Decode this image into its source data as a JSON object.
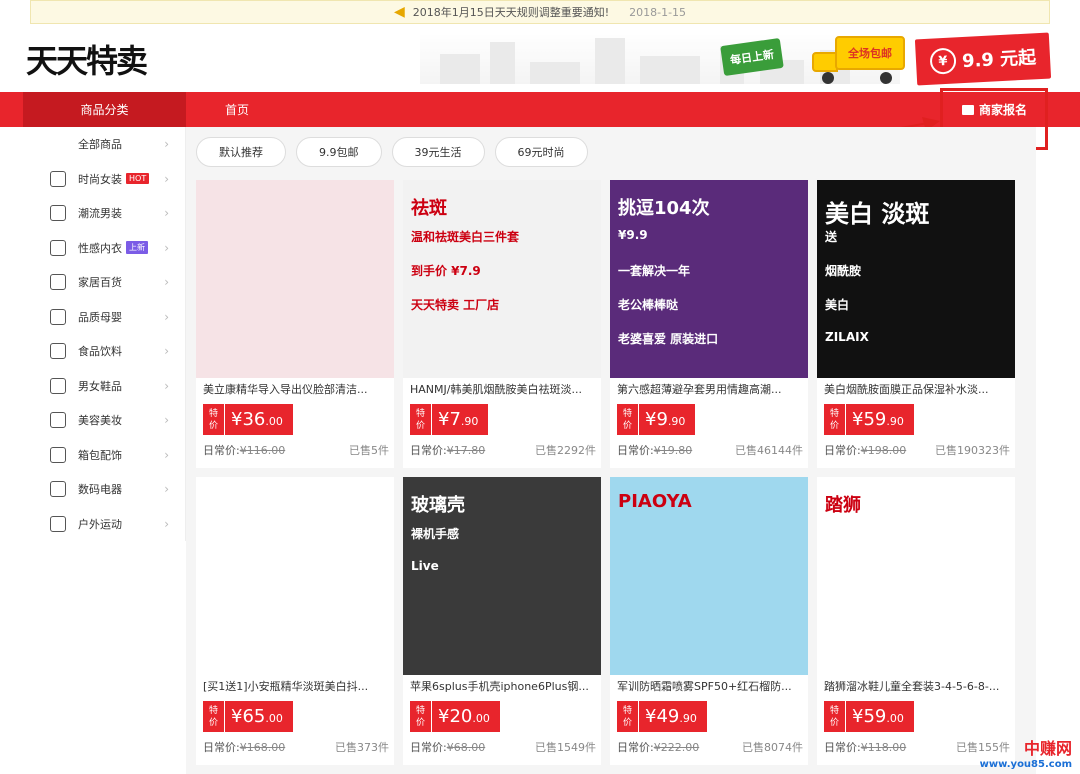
{
  "notice": {
    "text": "2018年1月15日天天规则调整重要通知!",
    "date": "2018-1-15"
  },
  "logo": {
    "text": "天天特卖"
  },
  "banner": {
    "daily_new": "每日上新",
    "free_shipping": "全场包邮",
    "yen": "¥",
    "price_from": "9.9 元起"
  },
  "nav": {
    "category": "商品分类",
    "home": "首页",
    "merchant": "商家报名"
  },
  "sidebar": {
    "items": [
      {
        "label": "全部商品",
        "icon": "all-icon",
        "tag": ""
      },
      {
        "label": "时尚女装",
        "icon": "dress-icon",
        "tag": "HOT"
      },
      {
        "label": "潮流男装",
        "icon": "shirt-icon",
        "tag": ""
      },
      {
        "label": "性感内衣",
        "icon": "bra-icon",
        "tag": "上新"
      },
      {
        "label": "家居百货",
        "icon": "home-icon",
        "tag": ""
      },
      {
        "label": "品质母婴",
        "icon": "bottle-icon",
        "tag": ""
      },
      {
        "label": "食品饮料",
        "icon": "food-icon",
        "tag": ""
      },
      {
        "label": "男女鞋品",
        "icon": "shoe-icon",
        "tag": ""
      },
      {
        "label": "美容美妆",
        "icon": "cosmetic-icon",
        "tag": ""
      },
      {
        "label": "箱包配饰",
        "icon": "watch-icon",
        "tag": ""
      },
      {
        "label": "数码电器",
        "icon": "camera-icon",
        "tag": ""
      },
      {
        "label": "户外运动",
        "icon": "outdoor-icon",
        "tag": ""
      }
    ]
  },
  "filters": [
    "默认推荐",
    "9.9包邮",
    "39元生活",
    "69元时尚"
  ],
  "labels": {
    "te": "特",
    "jia": "价",
    "usual": "日常价:",
    "sold_prefix": "已售",
    "sold_suffix": "件"
  },
  "products": [
    {
      "title": "美立康精华导入导出仪脸部清洁...",
      "price_int": "¥36",
      "price_dec": ".00",
      "usual": "¥116.00",
      "sold": "5",
      "bg": "#f6e3e6",
      "overlay": ""
    },
    {
      "title": "HANMJ/韩美肌烟酰胺美白祛斑淡...",
      "price_int": "¥7",
      "price_dec": ".90",
      "usual": "¥17.80",
      "sold": "2292",
      "bg": "#f2f2f2",
      "overlay": "祛斑 | 温和祛斑美白三件套 | 到手价 ¥7.9 | 天天特卖 工厂店"
    },
    {
      "title": "第六感超薄避孕套男用情趣高潮...",
      "price_int": "¥9",
      "price_dec": ".90",
      "usual": "¥19.80",
      "sold": "46144",
      "bg": "#5a2b7a",
      "overlay": "挑逗104次 | ¥9.9 | 一套解决一年 | 老公棒棒哒 | 老婆喜爱 原装进口"
    },
    {
      "title": "美白烟酰胺面膜正品保湿补水淡...",
      "price_int": "¥59",
      "price_dec": ".90",
      "usual": "¥198.00",
      "sold": "190323",
      "bg": "#111111",
      "overlay": "美白 淡斑 | 送 | 烟酰胺 | 美白 | ZILAIX"
    },
    {
      "title": "[买1送1]小安瓶精华淡斑美白抖...",
      "price_int": "¥65",
      "price_dec": ".00",
      "usual": "¥168.00",
      "sold": "373",
      "bg": "#ffffff",
      "overlay": ""
    },
    {
      "title": "苹果6splus手机壳iphone6Plus钢...",
      "price_int": "¥20",
      "price_dec": ".00",
      "usual": "¥68.00",
      "sold": "1549",
      "bg": "#3a3a3a",
      "overlay": "玻璃壳 | 裸机手感 | Live"
    },
    {
      "title": "军训防晒霜喷雾SPF50+红石榴防...",
      "price_int": "¥49",
      "price_dec": ".90",
      "usual": "¥222.00",
      "sold": "8074",
      "bg": "#9fd8ee",
      "overlay": "PIAOYA"
    },
    {
      "title": "踏狮溜冰鞋儿童全套装3-4-5-6-8-...",
      "price_int": "¥59",
      "price_dec": ".00",
      "usual": "¥118.00",
      "sold": "155",
      "bg": "#ffffff",
      "overlay": "踏狮"
    }
  ],
  "watermark": {
    "name": "中赚网",
    "url": "www.you85.com"
  },
  "colors": {
    "accent": "#e8252c",
    "nav_dark": "#c51a20"
  }
}
